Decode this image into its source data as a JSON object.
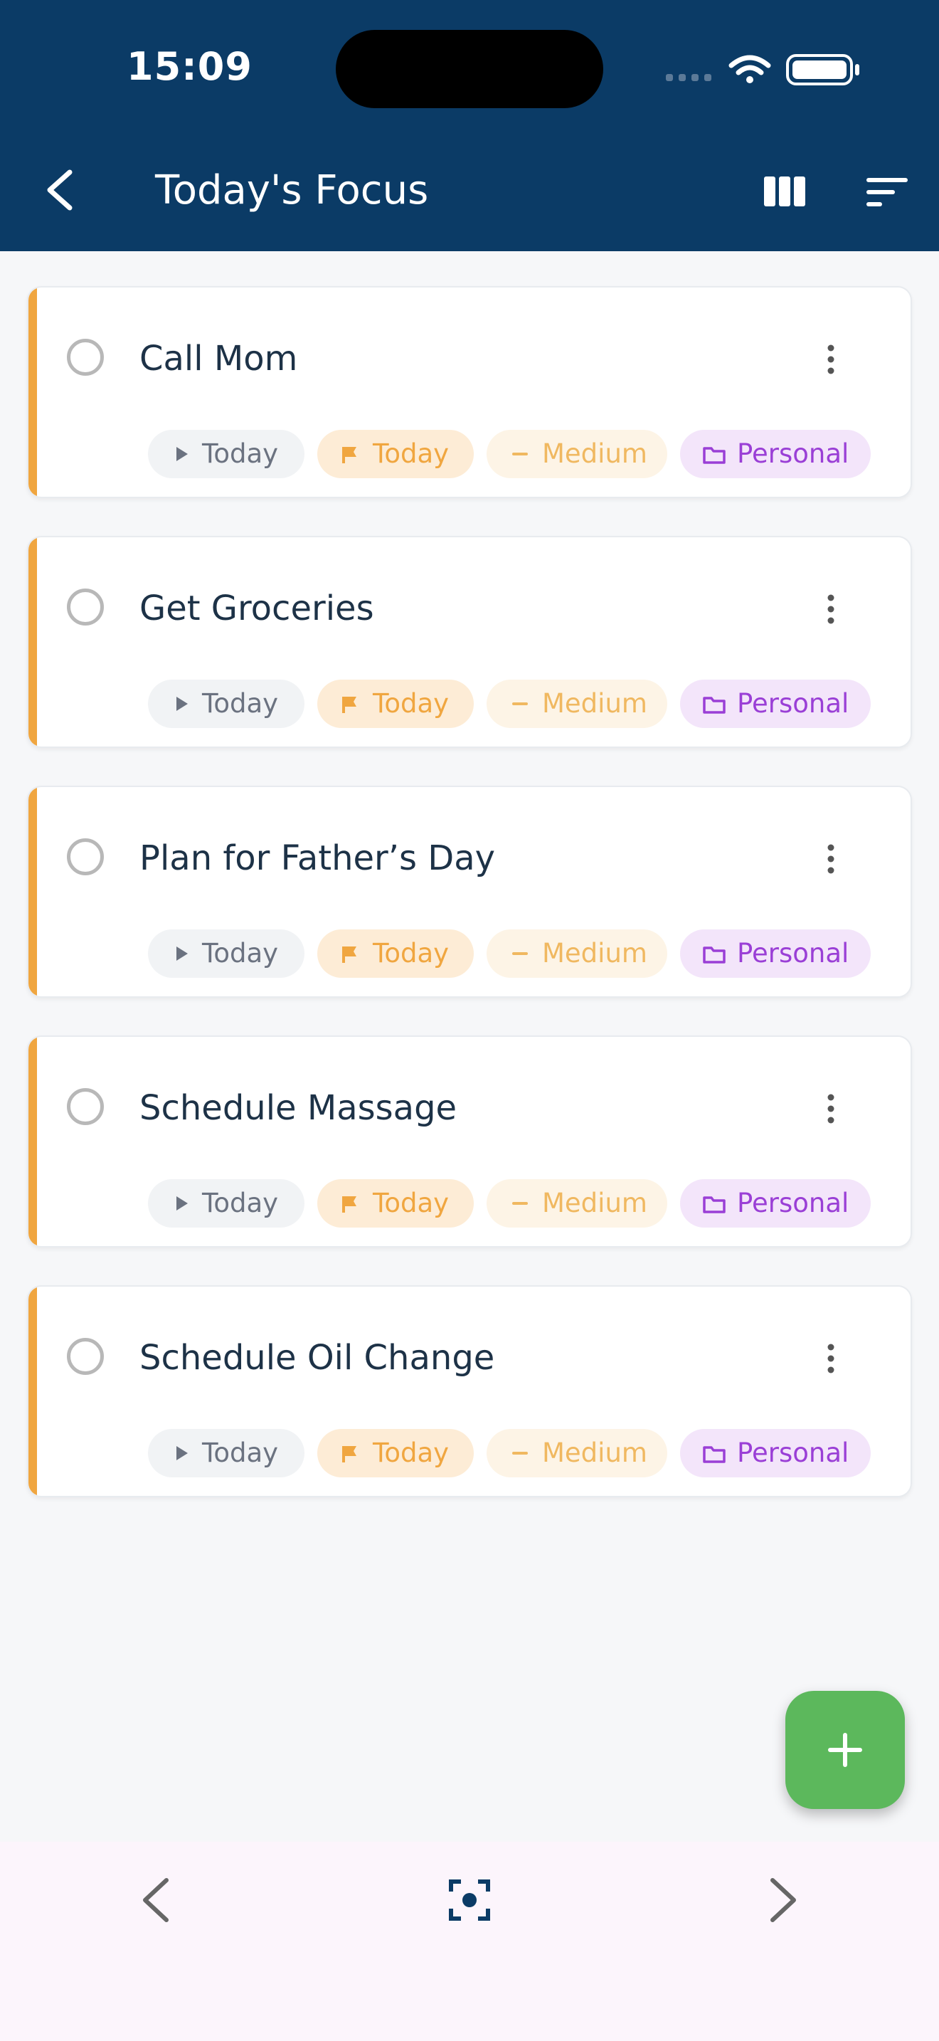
{
  "status_bar": {
    "time": "15:09"
  },
  "header": {
    "title": "Today's Focus"
  },
  "colors": {
    "header_bg": "#0b3b66",
    "accent": "#f0a640",
    "project": "#9a3fd6",
    "fab": "#5cb85c"
  },
  "tasks": [
    {
      "title": "Call Mom",
      "start": "Today",
      "due": "Today",
      "priority": "Medium",
      "project": "Personal"
    },
    {
      "title": "Get Groceries",
      "start": "Today",
      "due": "Today",
      "priority": "Medium",
      "project": "Personal"
    },
    {
      "title": "Plan for Father’s Day",
      "start": "Today",
      "due": "Today",
      "priority": "Medium",
      "project": "Personal"
    },
    {
      "title": "Schedule Massage",
      "start": "Today",
      "due": "Today",
      "priority": "Medium",
      "project": "Personal"
    },
    {
      "title": "Schedule Oil Change",
      "start": "Today",
      "due": "Today",
      "priority": "Medium",
      "project": "Personal"
    }
  ],
  "icons": {
    "back": "chevron-left-icon",
    "columns": "columns-icon",
    "sort": "sort-icon",
    "more": "more-vert-icon",
    "start": "play-icon",
    "due": "flag-icon",
    "priority": "dash-icon",
    "project": "folder-icon",
    "add": "plus-icon",
    "nav_prev": "chevron-left-icon",
    "nav_center": "focus-icon",
    "nav_next": "chevron-right-icon"
  }
}
